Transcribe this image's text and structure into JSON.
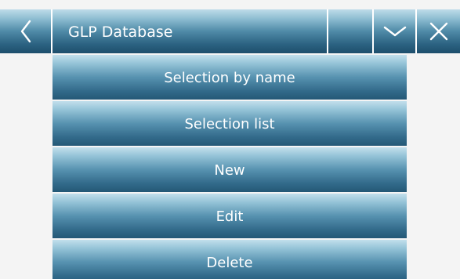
{
  "header": {
    "title": "GLP Database",
    "back_icon": "chevron-left-icon",
    "down_icon": "chevron-down-icon",
    "close_icon": "close-icon"
  },
  "menu": {
    "items": [
      {
        "label": "Selection by name"
      },
      {
        "label": "Selection list"
      },
      {
        "label": "New"
      },
      {
        "label": "Edit"
      },
      {
        "label": "Delete"
      }
    ]
  },
  "colors": {
    "button_top": "#c2dfec",
    "button_bottom": "#245876",
    "background": "#f4f4f4",
    "text": "#ffffff"
  }
}
